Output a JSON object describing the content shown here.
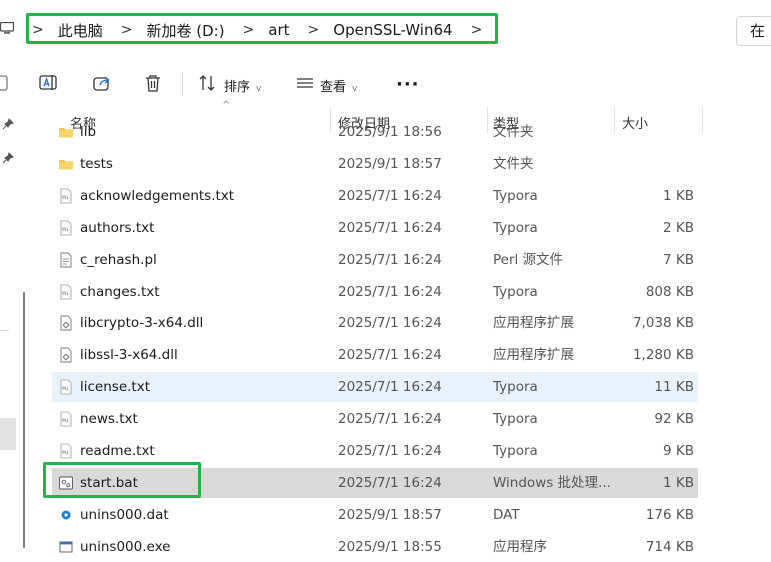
{
  "address": {
    "segments": [
      "此电脑",
      "新加卷 (D:)",
      "art",
      "OpenSSL-Win64"
    ],
    "separator": ">"
  },
  "search": {
    "label": "在"
  },
  "toolbar": {
    "sort_label": "排序",
    "view_label": "查看",
    "more_label": "···"
  },
  "columns": {
    "name": "名称",
    "date": "修改日期",
    "type": "类型",
    "size": "大小"
  },
  "files": [
    {
      "name": "lib",
      "date": "2025/9/1 18:56",
      "type": "文件夹",
      "size": "",
      "icon": "folder-icon"
    },
    {
      "name": "tests",
      "date": "2025/9/1 18:57",
      "type": "文件夹",
      "size": "",
      "icon": "folder-icon"
    },
    {
      "name": "acknowledgements.txt",
      "date": "2025/7/1 16:24",
      "type": "Typora",
      "size": "1 KB",
      "icon": "md-file-icon"
    },
    {
      "name": "authors.txt",
      "date": "2025/7/1 16:24",
      "type": "Typora",
      "size": "2 KB",
      "icon": "md-file-icon"
    },
    {
      "name": "c_rehash.pl",
      "date": "2025/7/1 16:24",
      "type": "Perl 源文件",
      "size": "7 KB",
      "icon": "text-file-icon"
    },
    {
      "name": "changes.txt",
      "date": "2025/7/1 16:24",
      "type": "Typora",
      "size": "808 KB",
      "icon": "md-file-icon"
    },
    {
      "name": "libcrypto-3-x64.dll",
      "date": "2025/7/1 16:24",
      "type": "应用程序扩展",
      "size": "7,038 KB",
      "icon": "dll-file-icon"
    },
    {
      "name": "libssl-3-x64.dll",
      "date": "2025/7/1 16:24",
      "type": "应用程序扩展",
      "size": "1,280 KB",
      "icon": "dll-file-icon"
    },
    {
      "name": "license.txt",
      "date": "2025/7/1 16:24",
      "type": "Typora",
      "size": "11 KB",
      "icon": "md-file-icon"
    },
    {
      "name": "news.txt",
      "date": "2025/7/1 16:24",
      "type": "Typora",
      "size": "92 KB",
      "icon": "md-file-icon"
    },
    {
      "name": "readme.txt",
      "date": "2025/7/1 16:24",
      "type": "Typora",
      "size": "9 KB",
      "icon": "md-file-icon"
    },
    {
      "name": "start.bat",
      "date": "2025/7/1 16:24",
      "type": "Windows 批处理...",
      "size": "1 KB",
      "icon": "bat-file-icon"
    },
    {
      "name": "unins000.dat",
      "date": "2025/9/1 18:57",
      "type": "DAT",
      "size": "176 KB",
      "icon": "dat-file-icon"
    },
    {
      "name": "unins000.exe",
      "date": "2025/9/1 18:55",
      "type": "应用程序",
      "size": "714 KB",
      "icon": "exe-file-icon"
    }
  ],
  "colors": {
    "highlight_border": "#25b24a",
    "hover_row": "#e9f2fb",
    "selected_row": "#d9d9d9",
    "folder": "#f3c24c",
    "dat_icon": "#1e7fd6"
  }
}
